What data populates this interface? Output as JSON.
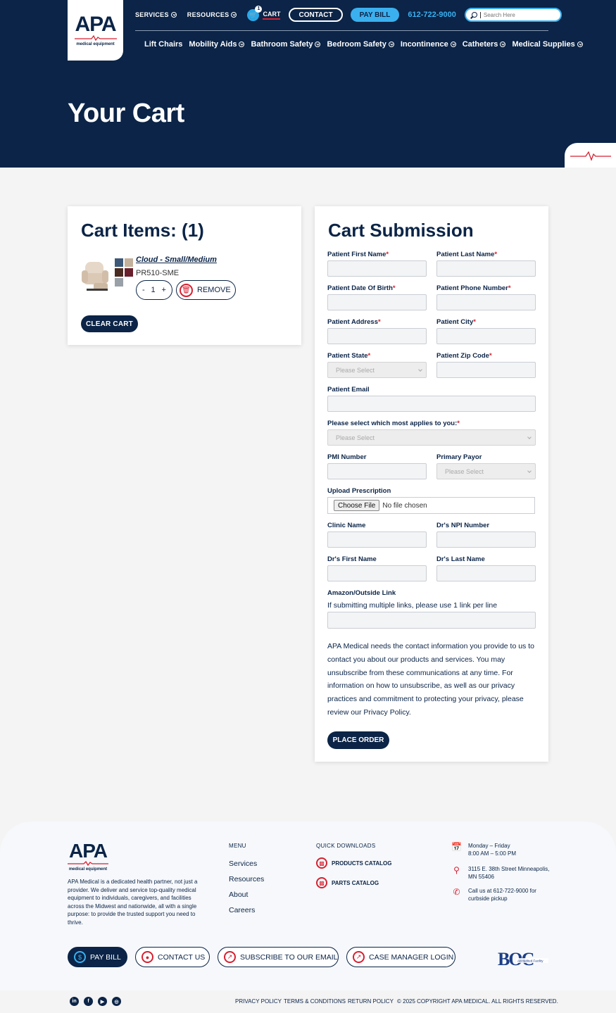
{
  "header": {
    "logo_text": "APA",
    "logo_sub": "medical equipment",
    "top_nav": [
      "SERVICES",
      "RESOURCES"
    ],
    "cart_label": "CART",
    "cart_count": "1",
    "contact_label": "CONTACT",
    "pay_bill_label": "PAY BILL",
    "phone": "612-722-9000",
    "search_placeholder": "Search Here",
    "main_nav": [
      {
        "label": "Lift Chairs",
        "has_dropdown": false
      },
      {
        "label": "Mobility Aids",
        "has_dropdown": true
      },
      {
        "label": "Bathroom Safety",
        "has_dropdown": true
      },
      {
        "label": "Bedroom Safety",
        "has_dropdown": true
      },
      {
        "label": "Incontinence",
        "has_dropdown": true
      },
      {
        "label": "Catheters",
        "has_dropdown": true
      },
      {
        "label": "Medical Supplies",
        "has_dropdown": true
      }
    ]
  },
  "page_title": "Your Cart",
  "cart": {
    "heading": "Cart Items: (1)",
    "item": {
      "name": "Cloud - Small/Medium",
      "sku": "PR510-SME",
      "quantity": "1",
      "minus": "-",
      "plus": "+",
      "swatch_colors": [
        "#3d5878",
        "#c4b19c",
        "#4a2b22",
        "#6a1f2c",
        "#9aa0a8"
      ]
    },
    "remove_label": "REMOVE",
    "clear_label": "CLEAR CART"
  },
  "submission": {
    "heading": "Cart Submission",
    "labels": {
      "first_name": "Patient First Name",
      "last_name": "Patient Last Name",
      "dob": "Patient Date Of Birth",
      "phone": "Patient Phone Number",
      "address": "Patient Address",
      "city": "Patient City",
      "state": "Patient State",
      "zip": "Patient Zip Code",
      "email": "Patient Email",
      "applies": "Please select which most applies to you:",
      "pmi": "PMI Number",
      "payor": "Primary Payor",
      "upload": "Upload Prescription",
      "clinic": "Clinic Name",
      "npi": "Dr's NPI Number",
      "dr_first": "Dr's First Name",
      "dr_last": "Dr's Last Name",
      "amazon": "Amazon/Outside Link",
      "amazon_help": "If submitting multiple links, please use 1 link per line"
    },
    "required_mark": "*",
    "select_placeholder": "Please Select",
    "file_button": "Choose File",
    "file_status": "No file chosen",
    "disclaimer": "APA Medical needs the contact information you provide to us to contact you about our products and services. You may unsubscribe from these communications at any time. For information on how to unsubscribe, as well as our privacy practices and commitment to protecting your privacy, please review our Privacy Policy.",
    "submit_label": "PLACE ORDER"
  },
  "footer": {
    "about": "APA Medical is a dedicated health partner, not just a provider. We deliver and service top-quality medical equipment to individuals, caregivers, and facilities across the Midwest and nationwide, all with a single purpose: to provide the trusted support you need to thrive.",
    "menu_heading": "MENU",
    "menu": [
      "Services",
      "Resources",
      "About",
      "Careers"
    ],
    "downloads_heading": "QUICK DOWNLOADS",
    "downloads": [
      "PRODUCTS CATALOG",
      "PARTS CATALOG"
    ],
    "hours_1": "Monday – Friday",
    "hours_2": "8:00 AM – 5:00 PM",
    "address_1": "3115 E. 38th Street Minneapolis,",
    "address_2": "MN 55406",
    "call_1": "Call us at 612-722-9000 for",
    "call_2": "curbside pickup",
    "buttons": [
      "PAY BILL",
      "CONTACT US",
      "SUBSCRIBE TO OUR EMAIL",
      "CASE MANAGER LOGIN"
    ],
    "boc_text": "BOC",
    "boc_sub": "Accredited Facility",
    "social": [
      "in",
      "f",
      "▶",
      "◎"
    ],
    "legal": [
      "PRIVACY POLICY",
      "TERMS & CONDITIONS",
      "RETURN POLICY",
      "© 2025 COPYRIGHT APA MEDICAL. ALL RIGHTS RESERVED."
    ]
  },
  "colors": {
    "navy": "#0b2447",
    "accent_blue": "#3bb0ef",
    "accent_red": "#d62031"
  }
}
